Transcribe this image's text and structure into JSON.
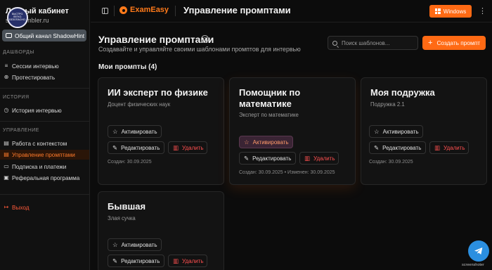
{
  "sidebar": {
    "title": "Личный кабинет",
    "email": "s...@rambler.ru",
    "badge_text": "БЫСТРО. ЛЕГКО. БЕЗОПАСНО.",
    "channel_label": "Общий канал ShadowHint",
    "sections": {
      "dashboards": "ДАШБОРДЫ",
      "history": "ИСТОРИЯ",
      "management": "УПРАВЛЕНИЕ"
    },
    "items": {
      "sessions": "Сессии интервью",
      "test": "Протестировать",
      "history": "История интервью",
      "context": "Работа с контекстом",
      "prompts": "Управление промптами",
      "billing": "Подписка и платежи",
      "referral": "Реферальная программа",
      "logout": "Выход"
    }
  },
  "topbar": {
    "brand": "ExamEasy",
    "title": "Управление промптами",
    "windows_label": "Windows"
  },
  "main": {
    "title": "Управление промптами",
    "subtitle": "Создавайте и управляйте своими шаблонами промптов для интервью",
    "search_placeholder": "Поиск шаблонов...",
    "create_label": "Создать промпт",
    "section_heading": "Мои промпты (4)"
  },
  "cards": [
    {
      "title": "ИИ эксперт по физике",
      "desc": "Доцент физических наук",
      "activate": "Активировать",
      "edit": "Редактировать",
      "delete": "Удалить",
      "date": "Создан: 30.09.2025"
    },
    {
      "title": "Помощник по математике",
      "desc": "Эксперт по математике",
      "activate": "Активировать",
      "edit": "Редактировать",
      "delete": "Удалить",
      "date": "Создан: 30.09.2025 • Изменен: 30.09.2025"
    },
    {
      "title": "Моя подружка",
      "desc": "Подружка 2.1",
      "activate": "Активировать",
      "edit": "Редактировать",
      "delete": "Удалить",
      "date": "Создан: 30.09.2025"
    },
    {
      "title": "Бывшая",
      "desc": "Злая сучка",
      "activate": "Активировать",
      "edit": "Редактировать",
      "delete": "Удалить"
    }
  ],
  "watermark": "screenshoter",
  "colors": {
    "accent": "#ff6a14",
    "danger": "#ff5050",
    "telegram": "#2b8fe0"
  },
  "icons": {
    "toggle": "sidebar-toggle-icon",
    "logo": "examease-logo-icon",
    "windows": "windows-icon",
    "search": "search-icon",
    "help": "question-circle-icon",
    "star": "star-icon",
    "edit": "edit-icon",
    "trash": "trash-icon",
    "telegram": "telegram-icon"
  }
}
